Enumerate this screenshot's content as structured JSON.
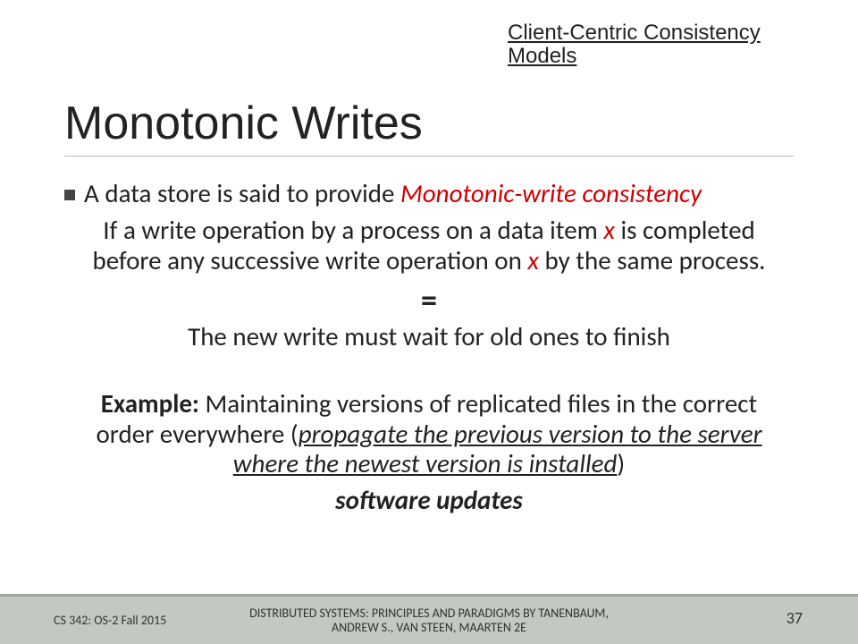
{
  "topic_label": "Client-Centric Consistency Models",
  "title": "Monotonic Writes",
  "lead_prefix": "A data store is said to provide ",
  "lead_term": "Monotonic-write consistency",
  "def_p1": "If a write operation by a process on a data item ",
  "def_x1": "x",
  "def_p2": " is completed before any successive write operation on ",
  "def_x2": "x",
  "def_p3": " by the same process.",
  "equals": "=",
  "plain": "The new write must wait for old ones to finish",
  "example_label": "Example:",
  "example_p1": " Maintaining versions of replicated files in the correct order everywhere (",
  "example_u": "propagate the previous version to the server where the newest version is installed",
  "example_p2": ")",
  "software": "software updates",
  "footer_left": "CS 342:  OS-2  Fall 2015",
  "footer_center_l1": "DISTRIBUTED SYSTEMS: PRINCIPLES AND PARADIGMS BY TANENBAUM,",
  "footer_center_l2": "ANDREW S., VAN STEEN, MAARTEN 2E",
  "footer_right": "37"
}
